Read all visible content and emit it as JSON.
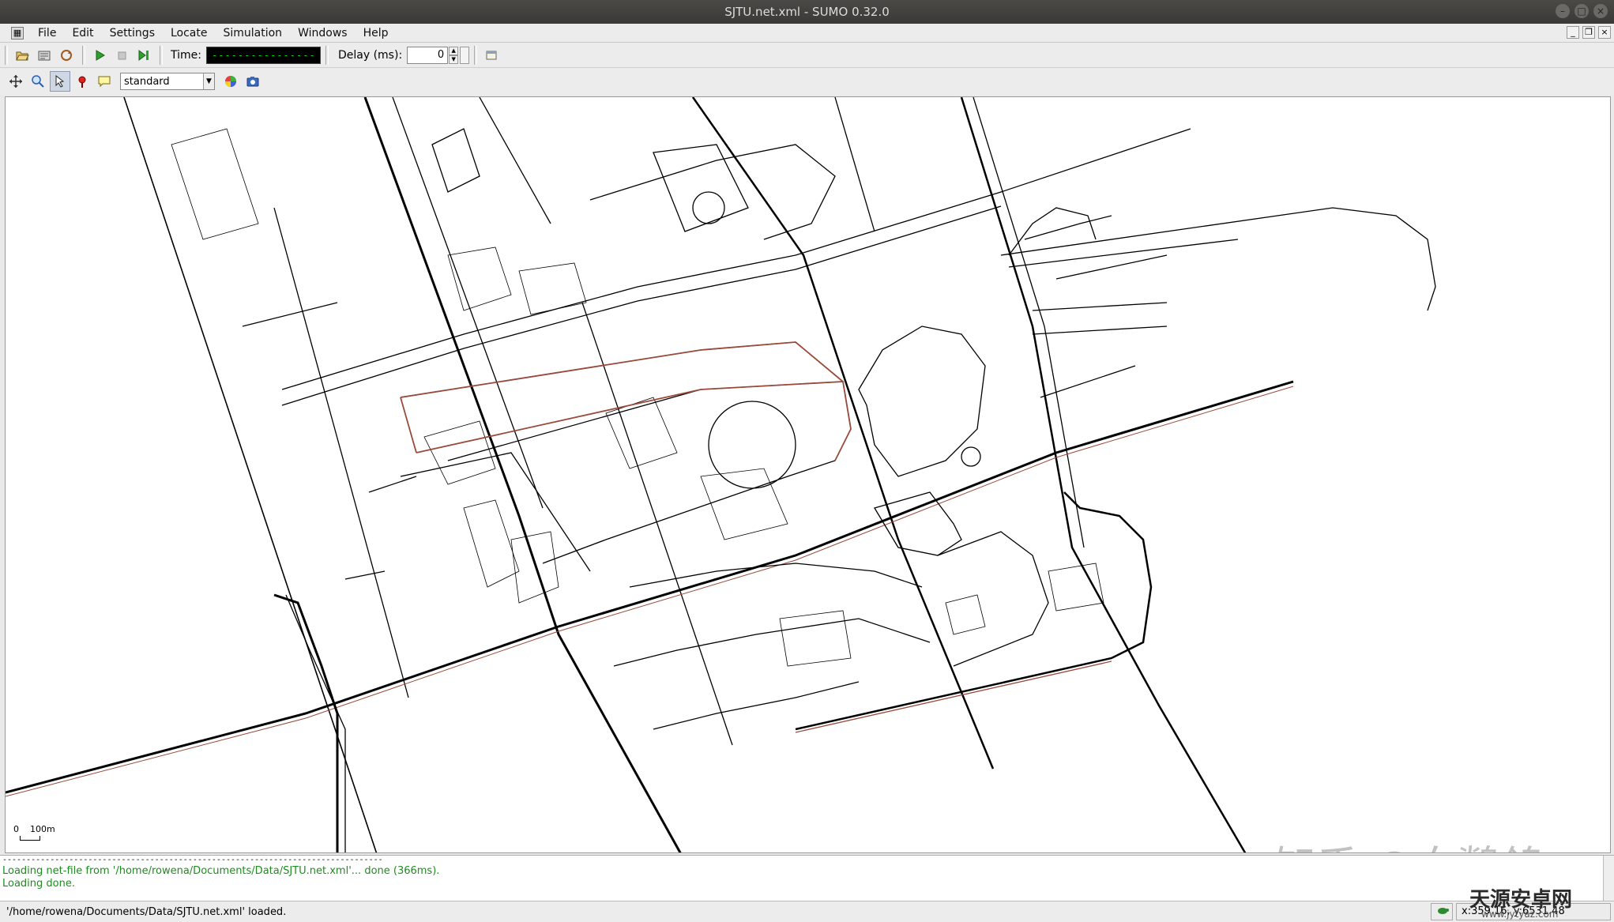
{
  "window": {
    "title": "SJTU.net.xml - SUMO 0.32.0"
  },
  "menu": {
    "items": [
      "File",
      "Edit",
      "Settings",
      "Locate",
      "Simulation",
      "Windows",
      "Help"
    ]
  },
  "toolbar": {
    "time_label": "Time:",
    "time_value": "------------------",
    "delay_label": "Delay (ms):",
    "delay_value": "0"
  },
  "view_toolbar": {
    "scheme": "standard"
  },
  "canvas": {
    "scale_start": "0",
    "scale_end": "100m"
  },
  "log": {
    "separator": "--------------------------------------------------------------------------------",
    "lines": [
      "Loading net-file from '/home/rowena/Documents/Data/SJTU.net.xml'... done (366ms).",
      "Loading done."
    ]
  },
  "status": {
    "message": "'/home/rowena/Documents/Data/SJTU.net.xml' loaded.",
    "coords": "x:359.16, y:6531.48"
  },
  "watermark": {
    "zhihu": "知乎 @白鹡鸰",
    "site": "天源安卓网",
    "site_url": "www.jytyaz.com"
  },
  "colors": {
    "road": "#000000",
    "highlight": "#9a4a3a",
    "log_green": "#1e8c1e"
  }
}
